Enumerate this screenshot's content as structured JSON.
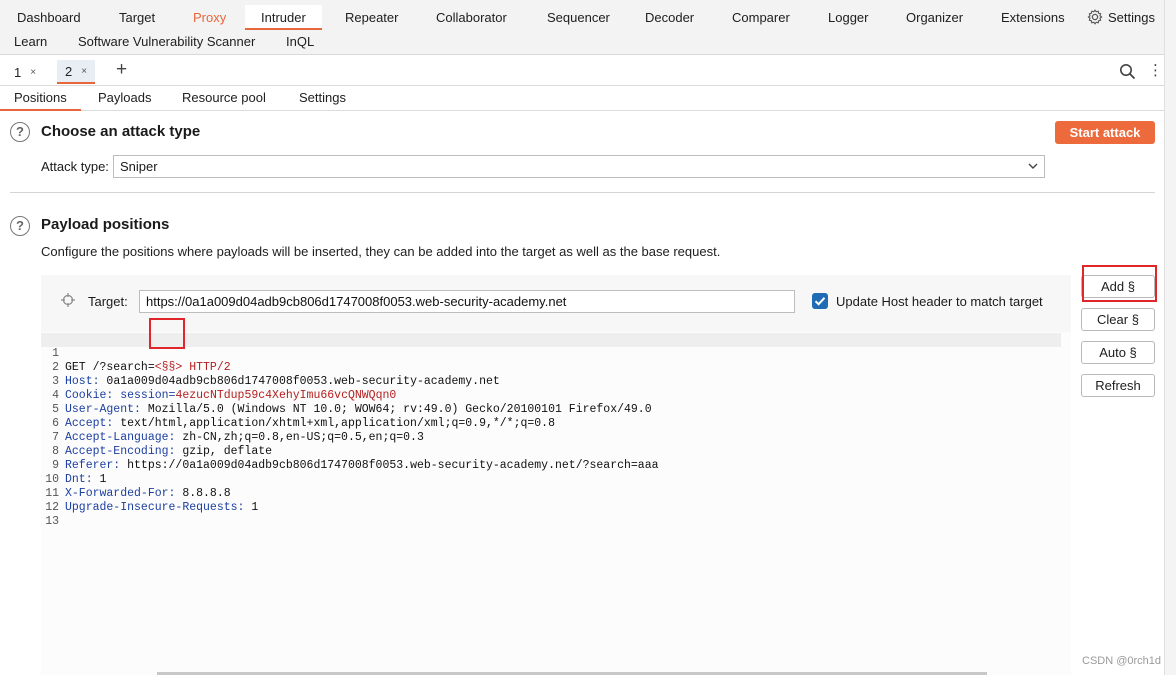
{
  "menu": {
    "row1": [
      "Dashboard",
      "Target",
      "Proxy",
      "Intruder",
      "Repeater",
      "Collaborator",
      "Sequencer",
      "Decoder",
      "Comparer",
      "Logger",
      "Organizer",
      "Extensions"
    ],
    "row2": [
      "Learn",
      "Software Vulnerability Scanner",
      "InQL"
    ],
    "settings_label": "Settings",
    "active": "Intruder",
    "accent_color": "#e8663c"
  },
  "instance_tabs": [
    {
      "label": "1",
      "close": "×"
    },
    {
      "label": "2",
      "close": "×"
    }
  ],
  "add_tab": "+",
  "sub_tabs": [
    "Positions",
    "Payloads",
    "Resource pool",
    "Settings"
  ],
  "attack": {
    "title": "Choose an attack type",
    "start_button": "Start attack",
    "type_label": "Attack type:",
    "type_value": "Sniper"
  },
  "payload_positions": {
    "title": "Payload positions",
    "description": "Configure the positions where payloads will be inserted, they can be added into the target as well as the base request.",
    "target_label": "Target:",
    "target_value": "https://0a1a009d04adb9cb806d1747008f0053.web-security-academy.net",
    "update_host_label": "Update Host header to match target",
    "update_host_checked": true
  },
  "request_lines": [
    {
      "n": "1",
      "pre": "GET /?search=",
      "marker": "<§§>",
      "post": " HTTP/2"
    },
    {
      "n": "2",
      "key": "Host:",
      "val": " 0a1a009d04adb9cb806d1747008f0053.web-security-academy.net"
    },
    {
      "n": "3",
      "key": "Cookie:",
      "val": " session=",
      "red": "4ezucNTdup59c4XehyImu66vcQNWQqn0"
    },
    {
      "n": "4",
      "key": "User-Agent:",
      "val": " Mozilla/5.0 (Windows NT 10.0; WOW64; rv:49.0) Gecko/20100101 Firefox/49.0"
    },
    {
      "n": "5",
      "key": "Accept:",
      "val": " text/html,application/xhtml+xml,application/xml;q=0.9,*/*;q=0.8"
    },
    {
      "n": "6",
      "key": "Accept-Language:",
      "val": " zh-CN,zh;q=0.8,en-US;q=0.5,en;q=0.3"
    },
    {
      "n": "7",
      "key": "Accept-Encoding:",
      "val": " gzip, deflate"
    },
    {
      "n": "8",
      "key": "Referer:",
      "val": " https://0a1a009d04adb9cb806d1747008f0053.web-security-academy.net/?search=aaa"
    },
    {
      "n": "9",
      "key": "Dnt:",
      "val": " 1"
    },
    {
      "n": "10",
      "key": "X-Forwarded-For:",
      "val": " 8.8.8.8"
    },
    {
      "n": "11",
      "key": "Upgrade-Insecure-Requests:",
      "val": " 1"
    },
    {
      "n": "12"
    },
    {
      "n": "13"
    }
  ],
  "side_buttons": {
    "add": "Add §",
    "clear": "Clear §",
    "auto": "Auto §",
    "refresh": "Refresh"
  },
  "watermark": "CSDN @0rch1d"
}
